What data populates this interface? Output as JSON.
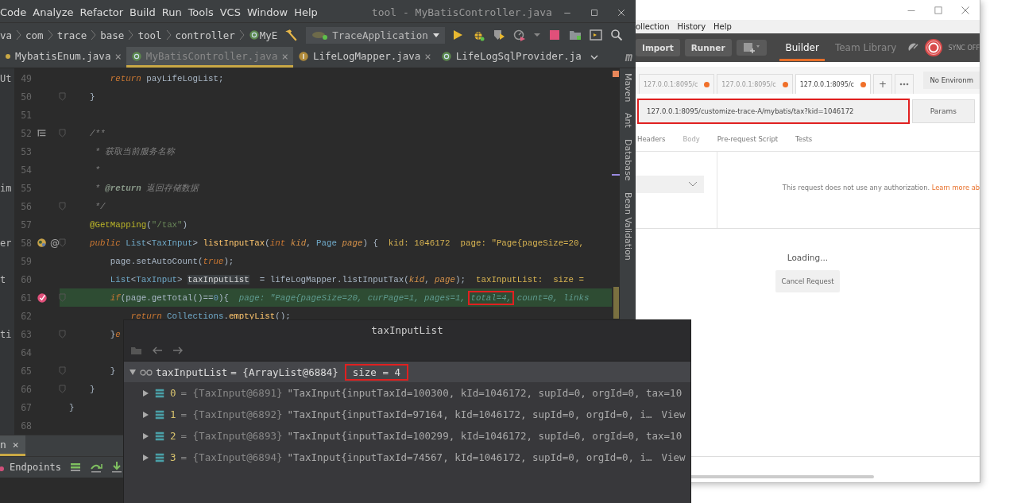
{
  "ide": {
    "menu": [
      "Code",
      "Analyze",
      "Refactor",
      "Build",
      "Run",
      "Tools",
      "VCS",
      "Window",
      "Help"
    ],
    "title": "tool - MyBatisController.java",
    "breadcrumbs": [
      "va",
      "com",
      "trace",
      "base",
      "tool",
      "controller",
      "MyE"
    ],
    "run_config": "TraceApplication",
    "tabs": [
      {
        "label": "MybatisEnum.java",
        "kind": "enum",
        "close": "×",
        "selected": false
      },
      {
        "label": "MyBatisController.java",
        "kind": "class",
        "close": "×",
        "selected": true
      },
      {
        "label": "LifeLogMapper.java",
        "kind": "interface",
        "close": "×",
        "selected": false
      },
      {
        "label": "LifeLogSqlProvider.ja",
        "kind": "class",
        "selected": false
      }
    ],
    "side_letter": "m",
    "lines": [
      {
        "number": "49",
        "project_text": "Ut",
        "fold": false,
        "current": false,
        "tokens": [
          {
            "kind": "keyword",
            "text": "        return"
          },
          {
            "kind": "plain",
            "text": " payLifeLogList;"
          }
        ]
      },
      {
        "number": "50",
        "fold": true,
        "current": false,
        "tokens": [
          {
            "kind": "plain",
            "text": "    }"
          }
        ]
      },
      {
        "number": "51",
        "fold": false,
        "current": false
      },
      {
        "number": "52",
        "gutter": {
          "kind": "list"
        },
        "fold": true,
        "current": false,
        "tokens": [
          {
            "kind": "comment",
            "text": "    /**"
          }
        ]
      },
      {
        "number": "53",
        "fold": false,
        "current": false,
        "tokens": [
          {
            "kind": "comment",
            "text": "     * 获取当前服务名称"
          }
        ]
      },
      {
        "number": "54",
        "fold": false,
        "current": false,
        "tokens": [
          {
            "kind": "comment",
            "text": "     *"
          }
        ]
      },
      {
        "number": "55",
        "project_text": "im",
        "fold": false,
        "current": false,
        "tokens": [
          {
            "kind": "comment",
            "text": "     * "
          },
          {
            "kind": "doctag",
            "text": "@return"
          },
          {
            "kind": "comment",
            "text": " 返回存储数据"
          }
        ]
      },
      {
        "number": "56",
        "fold": true,
        "current": false,
        "tokens": [
          {
            "kind": "comment",
            "text": "     */"
          }
        ]
      },
      {
        "number": "57",
        "fold": false,
        "current": false,
        "tokens": [
          {
            "kind": "annotation",
            "text": "    @GetMapping"
          },
          {
            "kind": "plain",
            "text": "("
          },
          {
            "kind": "string",
            "text": "\"/tax\""
          },
          {
            "kind": "plain",
            "text": ")"
          }
        ]
      },
      {
        "number": "58",
        "project_text": "er",
        "gutter": {
          "kind": "bean",
          "text": "@"
        },
        "fold": true,
        "current": false,
        "tokens": [
          {
            "kind": "keyword",
            "text": "    public "
          },
          {
            "kind": "type",
            "text": "List"
          },
          {
            "kind": "plain",
            "text": "<"
          },
          {
            "kind": "type",
            "text": "TaxInput"
          },
          {
            "kind": "plain",
            "text": "> "
          },
          {
            "kind": "fn",
            "text": "listInputTax"
          },
          {
            "kind": "plain",
            "text": "("
          },
          {
            "kind": "keyword",
            "text": "int "
          },
          {
            "kind": "param",
            "text": "kid"
          },
          {
            "kind": "plain",
            "text": ", "
          },
          {
            "kind": "type",
            "text": "Page "
          },
          {
            "kind": "param",
            "text": "page"
          },
          {
            "kind": "plain",
            "text": ") {  "
          },
          {
            "kind": "hint",
            "text": "kid: 1046172  page: \"Page{pageSize=20,"
          }
        ]
      },
      {
        "number": "59",
        "fold": false,
        "current": false,
        "tokens": [
          {
            "kind": "plain",
            "text": "        page.setAutoCount("
          },
          {
            "kind": "keyword",
            "text": "true"
          },
          {
            "kind": "plain",
            "text": ");"
          }
        ]
      },
      {
        "number": "60",
        "project_text": "t",
        "fold": false,
        "current": false,
        "tokens": [
          {
            "kind": "type",
            "text": "        List"
          },
          {
            "kind": "plain",
            "text": "<"
          },
          {
            "kind": "type",
            "text": "TaxInput"
          },
          {
            "kind": "plain",
            "text": "> "
          },
          {
            "kind": "selected",
            "text": "taxInputList"
          },
          {
            "kind": "plain",
            "text": "  = lifeLogMapper.listInputTax("
          },
          {
            "kind": "param",
            "text": "kid"
          },
          {
            "kind": "plain",
            "text": ", "
          },
          {
            "kind": "param",
            "text": "page"
          },
          {
            "kind": "plain",
            "text": ");  "
          },
          {
            "kind": "hint",
            "text": "taxInputList:  size ="
          }
        ]
      },
      {
        "number": "61",
        "gutter": {
          "kind": "breakpoint"
        },
        "fold": true,
        "current": true,
        "tokens": [
          {
            "kind": "keyword",
            "text": "        if"
          },
          {
            "kind": "plain",
            "text": "(page.getTotal()=="
          },
          {
            "kind": "number",
            "text": "0"
          },
          {
            "kind": "plain",
            "text": "){  "
          },
          {
            "kind": "inline",
            "text": "page: \"Page{pageSize=20, curPage=1, pages=1, "
          },
          {
            "kind": "boxed",
            "text": "total=4,"
          },
          {
            "kind": "inline",
            "text": " count=0, links"
          }
        ]
      },
      {
        "number": "62",
        "fold": false,
        "current": false,
        "tokens": [
          {
            "kind": "keyword",
            "text": "            return "
          },
          {
            "kind": "type",
            "text": "Collections"
          },
          {
            "kind": "plain",
            "text": "."
          },
          {
            "kind": "fn",
            "text": "emptyList"
          },
          {
            "kind": "plain",
            "text": "();"
          }
        ]
      },
      {
        "number": "63",
        "project_text": "ti",
        "fold": true,
        "current": false,
        "tokens": [
          {
            "kind": "plain",
            "text": "        }"
          },
          {
            "kind": "keyword",
            "text": "e"
          }
        ]
      },
      {
        "number": "64",
        "fold": false,
        "current": false
      },
      {
        "number": "65",
        "fold": true,
        "current": false,
        "tokens": [
          {
            "kind": "plain",
            "text": "        }"
          }
        ]
      },
      {
        "number": "66",
        "fold": true,
        "current": false,
        "tokens": [
          {
            "kind": "plain",
            "text": "    }"
          }
        ]
      },
      {
        "number": "67",
        "fold": false,
        "current": false,
        "tokens": [
          {
            "kind": "plain",
            "text": "}"
          }
        ]
      },
      {
        "number": "68",
        "fold": false,
        "current": false
      }
    ],
    "tool_windows": [
      "Maven",
      "Ant",
      "Database",
      "Bean Validation"
    ],
    "bottom_tab": {
      "label": "n",
      "close": "×"
    },
    "bottom_toolbar": {
      "label": "Endpoints"
    }
  },
  "debug_popup": {
    "title": "taxInputList",
    "root": {
      "expanded": true,
      "name": "taxInputList",
      "value": "= {ArrayList@6884}",
      "size": "size = 4",
      "size_boxed": true,
      "children": [
        {
          "expanded": false,
          "index": "0",
          "ref": "= {TaxInput@6891}",
          "value": "\"TaxInput{inputTaxId=100300, kId=1046172, supId=0, orgId=0, tax=10"
        },
        {
          "expanded": false,
          "index": "1",
          "ref": "= {TaxInput@6892}",
          "value": "\"TaxInput{inputTaxId=97164, kId=1046172, supId=0, orgId=0, i…",
          "link": "View"
        },
        {
          "expanded": false,
          "index": "2",
          "ref": "= {TaxInput@6893}",
          "value": "\"TaxInput{inputTaxId=100299, kId=1046172, supId=0, orgId=0, tax=10"
        },
        {
          "expanded": false,
          "index": "3",
          "ref": "= {TaxInput@6894}",
          "value": "\"TaxInput{inputTaxId=74567, kId=1046172, supId=0, orgId=0, i…",
          "link": "View"
        }
      ]
    }
  },
  "postman": {
    "menu": [
      "ollection",
      "History",
      "Help"
    ],
    "toolbar_buttons": [
      "Import",
      "Runner"
    ],
    "nav_tabs": [
      {
        "label": "Builder",
        "selected": true
      },
      {
        "label": "Team Library",
        "selected": false
      }
    ],
    "sync": "SYNC OFF",
    "request_tabs": [
      {
        "label": "127.0.0.1:8095/c",
        "unsaved": true,
        "selected": false
      },
      {
        "label": "127.0.0.1:8095/c",
        "unsaved": true,
        "selected": false
      },
      {
        "label": "127.0.0.1:8095/c",
        "unsaved": true,
        "selected": true
      }
    ],
    "add_tab": "+",
    "environment": "No Environm",
    "url": {
      "value": "127.0.0.1:8095/customize-trace-A/mybatis/tax?kid=1046172",
      "highlighted": true
    },
    "params": "Params",
    "sub_tabs": [
      {
        "label": "Headers",
        "disabled": false
      },
      {
        "label": "Body",
        "disabled": true
      },
      {
        "label": "Pre-request Script",
        "disabled": false
      },
      {
        "label": "Tests",
        "disabled": false
      }
    ],
    "auth_message": "This request does not use any authorization.",
    "auth_link": "Learn more ab",
    "loading": "Loading...",
    "cancel": "Cancel Request"
  }
}
